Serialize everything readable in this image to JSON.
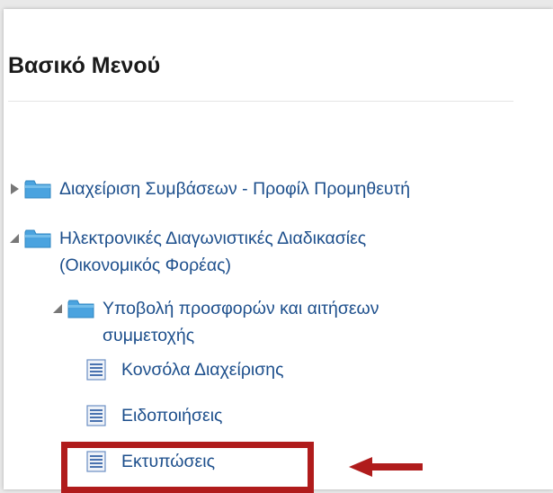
{
  "menu": {
    "title": "Βασικό Μενού",
    "items": [
      {
        "label": "Διαχείριση Συμβάσεων - Προφίλ Προμηθευτή",
        "state": "collapsed"
      },
      {
        "label_line1": "Ηλεκτρονικές Διαγωνιστικές Διαδικασίες",
        "label_line2": "(Οικονομικός Φορέας)",
        "state": "expanded"
      },
      {
        "label_line1": "Υποβολή προσφορών και αιτήσεων",
        "label_line2": "συμμετοχής",
        "state": "expanded"
      },
      {
        "label": "Κονσόλα Διαχείρισης",
        "icon": "page-icon"
      },
      {
        "label": "Ειδοποιήσεις",
        "icon": "page-icon"
      },
      {
        "label": "Εκτυπώσεις",
        "icon": "page-icon",
        "highlighted": true
      }
    ]
  },
  "colors": {
    "link": "#1d4f8c",
    "folder": "#4aa3df",
    "highlight": "#b01c1c"
  }
}
